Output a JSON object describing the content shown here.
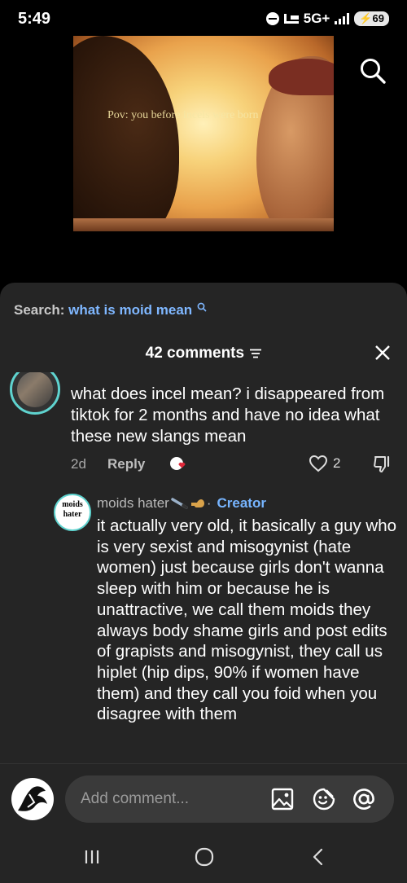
{
  "status_bar": {
    "time": "5:49",
    "network": "5G+",
    "battery": "69"
  },
  "video": {
    "caption": "Pov: you before incels were born"
  },
  "sheet": {
    "search_label": "Search:",
    "search_query": "what is moid mean",
    "comments_count": "42 comments"
  },
  "comments": [
    {
      "text": "what does incel mean? i disappeared from tiktok for 2 months and have no idea what these new slangs mean",
      "age": "2d",
      "reply_label": "Reply",
      "likes": "2",
      "liked_by_creator_badge": "moids hater"
    },
    {
      "username": "moids hater",
      "role_separator": "·",
      "role": "Creator",
      "avatar_text": "moids hater",
      "text": "it actually very old, it basically a guy who is very sexist and misogynist (hate women) just because girls don't wanna sleep with him or because he is unattractive, we call them moids they always body shame girls and post edits of grapists and misogynist, they call us hiplet (hip dips, 90% if women have them) and they call you foid when you disagree with them"
    }
  ],
  "input": {
    "placeholder": "Add comment..."
  },
  "colors": {
    "sheet_bg": "#252525",
    "link_blue": "#7fb7ff",
    "avatar_ring": "#5fd3cf"
  }
}
